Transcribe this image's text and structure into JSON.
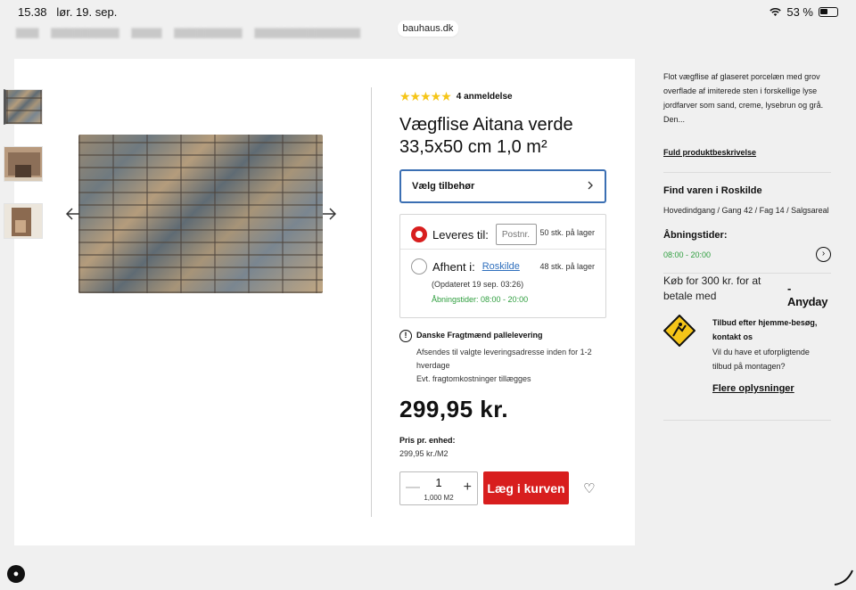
{
  "status_bar": {
    "time": "15.38",
    "date": "lør. 19. sep.",
    "battery": "53 %"
  },
  "browser": {
    "url": "bauhaus.dk"
  },
  "product": {
    "rating_stars": 5,
    "reviews": "4 anmeldelse",
    "title": "Vægflise Aitana verde 33,5x50 cm 1,0 m²",
    "accessory_label": "Vælg tilbehør",
    "delivery": {
      "deliver_label": "Leveres til:",
      "postnr_placeholder": "Postnr.",
      "deliver_stock": "50 stk. på lager",
      "pickup_label": "Afhent i:",
      "pickup_store": "Roskilde",
      "pickup_stock": "48 stk. på lager",
      "updated": "(Opdateret 19 sep. 03:26)",
      "hours": "Åbningstider: 08:00 - 20:00"
    },
    "shipping": {
      "title": "Danske Fragtmænd pallelevering",
      "line1": "Afsendes til valgte leveringsadresse inden for 1-2 hverdage",
      "line2": "Evt. fragtomkostninger tillægges"
    },
    "price": "299,95 kr.",
    "unit_price_label": "Pris pr. enhed:",
    "unit_price": "299,95 kr./M2",
    "quantity": "1",
    "quantity_unit": "1,000 M2",
    "add_to_cart": "Læg i kurven"
  },
  "sidebar": {
    "description": "Flot vægflise af glaseret porcelæn med grov overflade af imiterede sten i forskellige lyse jordfarver som sand, creme, lysebrun og grå.",
    "description_more": "Den...",
    "full_description_link": "Fuld produktbeskrivelse",
    "find_title": "Find varen i Roskilde",
    "location": "Hovedindgang / Gang 42 / Fag 14 / Salgsareal",
    "hours_title": "Åbningstider:",
    "hours": "08:00 - 20:00",
    "anyday_text": "Køb for 300 kr. for at betale med",
    "anyday_logo": "Anyday",
    "offer_title": "Tilbud efter hjemme-besøg, kontakt os",
    "offer_text": "Vil du have et uforpligtende tilbud på montagen?",
    "more_info": "Flere oplysninger"
  },
  "colors": {
    "accent_red": "#d81e1e",
    "link_blue": "#2f6fbd",
    "open_green": "#2e9e3e",
    "focus_blue": "#3b6fb3"
  }
}
